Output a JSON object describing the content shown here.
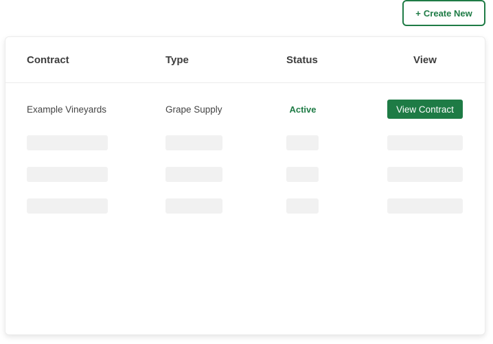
{
  "toolbar": {
    "create_icon": "plus-icon",
    "create_icon_glyph": "+",
    "create_label": "Create New"
  },
  "colors": {
    "accent": "#1e7b45",
    "skeleton": "#f1f1f1",
    "header_text": "#3d3d3d",
    "body_text": "#444444"
  },
  "table": {
    "columns": [
      {
        "key": "contract",
        "label": "Contract"
      },
      {
        "key": "type",
        "label": "Type"
      },
      {
        "key": "status",
        "label": "Status"
      },
      {
        "key": "view",
        "label": "View"
      }
    ],
    "rows": [
      {
        "contract": "Example Vineyards",
        "type": "Grape Supply",
        "status": "Active",
        "view_label": "View Contract"
      }
    ],
    "loading_placeholder_rows": 3
  }
}
